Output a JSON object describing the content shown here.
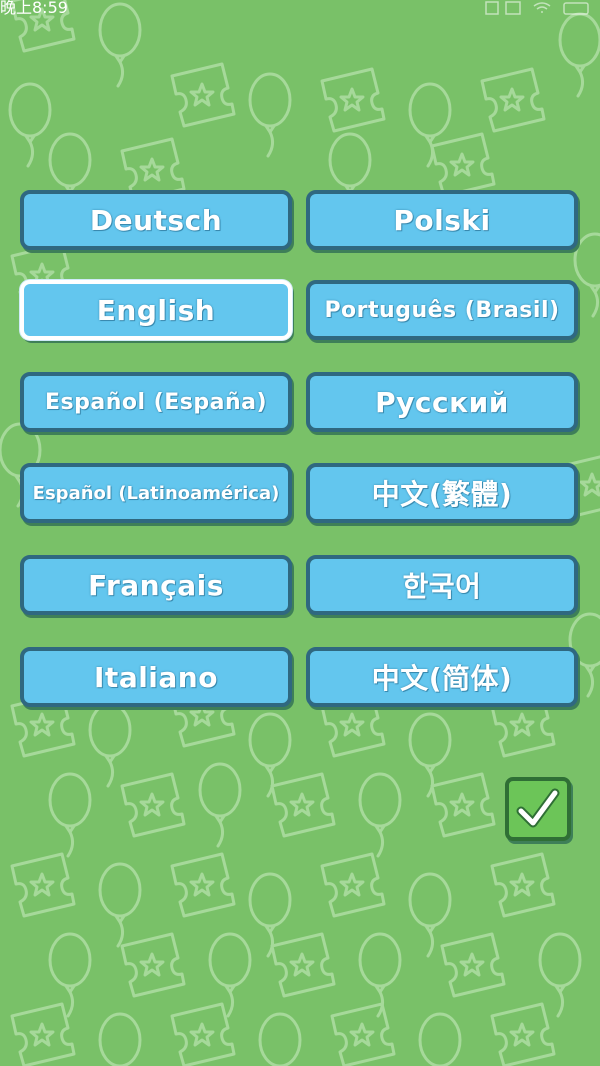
{
  "status_bar": {
    "time": "晚上8:59"
  },
  "languages": [
    {
      "label": "Deutsch",
      "selected": false
    },
    {
      "label": "Polski",
      "selected": false
    },
    {
      "label": "English",
      "selected": true
    },
    {
      "label": "Português (Brasil)",
      "selected": false
    },
    {
      "label": "Español (España)",
      "selected": false
    },
    {
      "label": "Русский",
      "selected": false
    },
    {
      "label": "Español (Latinoamérica)",
      "selected": false
    },
    {
      "label": "中文(繁體)",
      "selected": false
    },
    {
      "label": "Français",
      "selected": false
    },
    {
      "label": "한국어",
      "selected": false
    },
    {
      "label": "Italiano",
      "selected": false
    },
    {
      "label": "中文(简体)",
      "selected": false
    }
  ],
  "confirm": {
    "icon": "checkmark-icon"
  },
  "colors": {
    "background": "#79c168",
    "button_fill": "#63c6ee",
    "button_border": "#2f6880",
    "confirm_fill": "#6cc558"
  }
}
